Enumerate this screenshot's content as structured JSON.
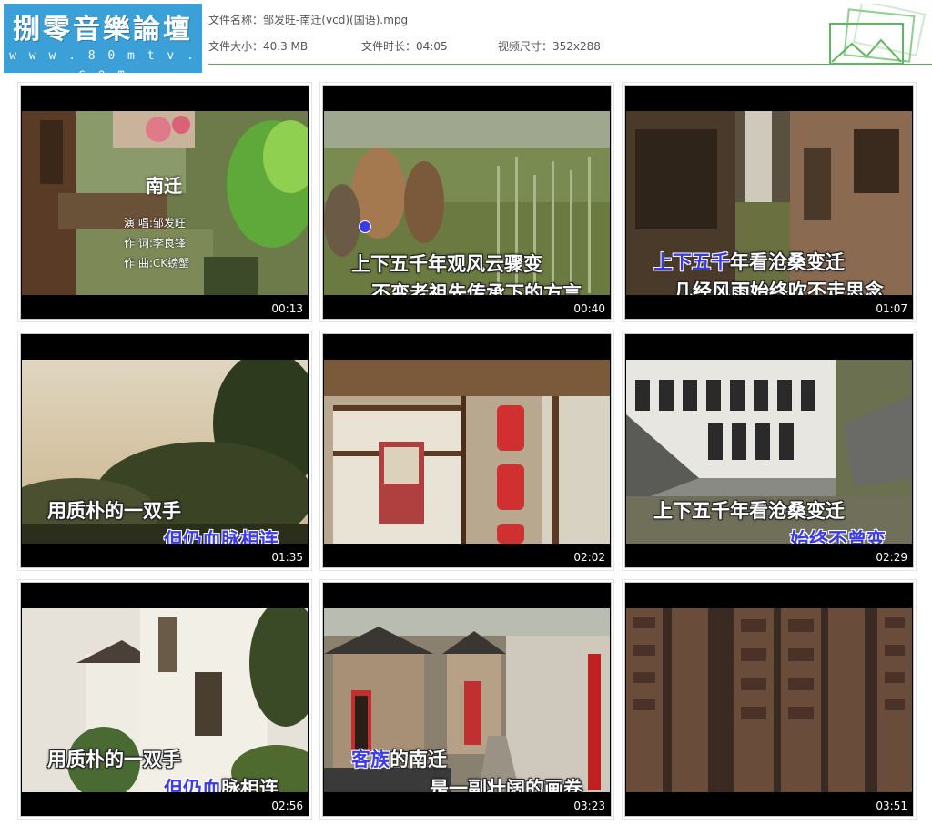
{
  "logo": {
    "title": "捌零音樂論壇",
    "url": "w w w . 8 0 m t v . c o m"
  },
  "file": {
    "name_label": "文件名称：",
    "name_value": "邹发旺-南迁(vcd)(国语).mpg",
    "size_label": "文件大小：",
    "size_value": "40.3 MB",
    "duration_label": "文件时长：",
    "duration_value": "04:05",
    "dims_label": "视频尺寸：",
    "dims_value": "352x288"
  },
  "colors": {
    "accent_line": "#4fae4f",
    "logo_bg": "#3ba0d8",
    "lyric_highlight": "#3a3ae8"
  },
  "thumbnails": [
    {
      "time": "00:13",
      "title": "南迁",
      "credits": [
        "演 唱:邹发旺",
        "作 词:李良锋",
        "作 曲:CK螃蟹"
      ]
    },
    {
      "time": "00:40",
      "icon": "vocal-marker-icon",
      "line1": "上下五千年观风云骤变",
      "line2": "不变老祖先传承下的方言"
    },
    {
      "time": "01:07",
      "line1_hl": "上下五千",
      "line1_rest": "年看沧桑变迁",
      "line2": "几经风雨始终吹不走思念"
    },
    {
      "time": "01:35",
      "line1": "用质朴的一双手",
      "line2_hl": "但仍血脉相连"
    },
    {
      "time": "02:02"
    },
    {
      "time": "02:29",
      "line1": "上下五千年看沧桑变迁",
      "line2_hl": "始终不曾变"
    },
    {
      "time": "02:56",
      "line1": "用质朴的一双手",
      "line2_hl": "但仍血",
      "line2_rest": "脉相连"
    },
    {
      "time": "03:23",
      "line1_hl": "客族",
      "line1_rest": "的南迁",
      "line2": "是一副壮阔的画卷"
    },
    {
      "time": "03:51"
    }
  ]
}
